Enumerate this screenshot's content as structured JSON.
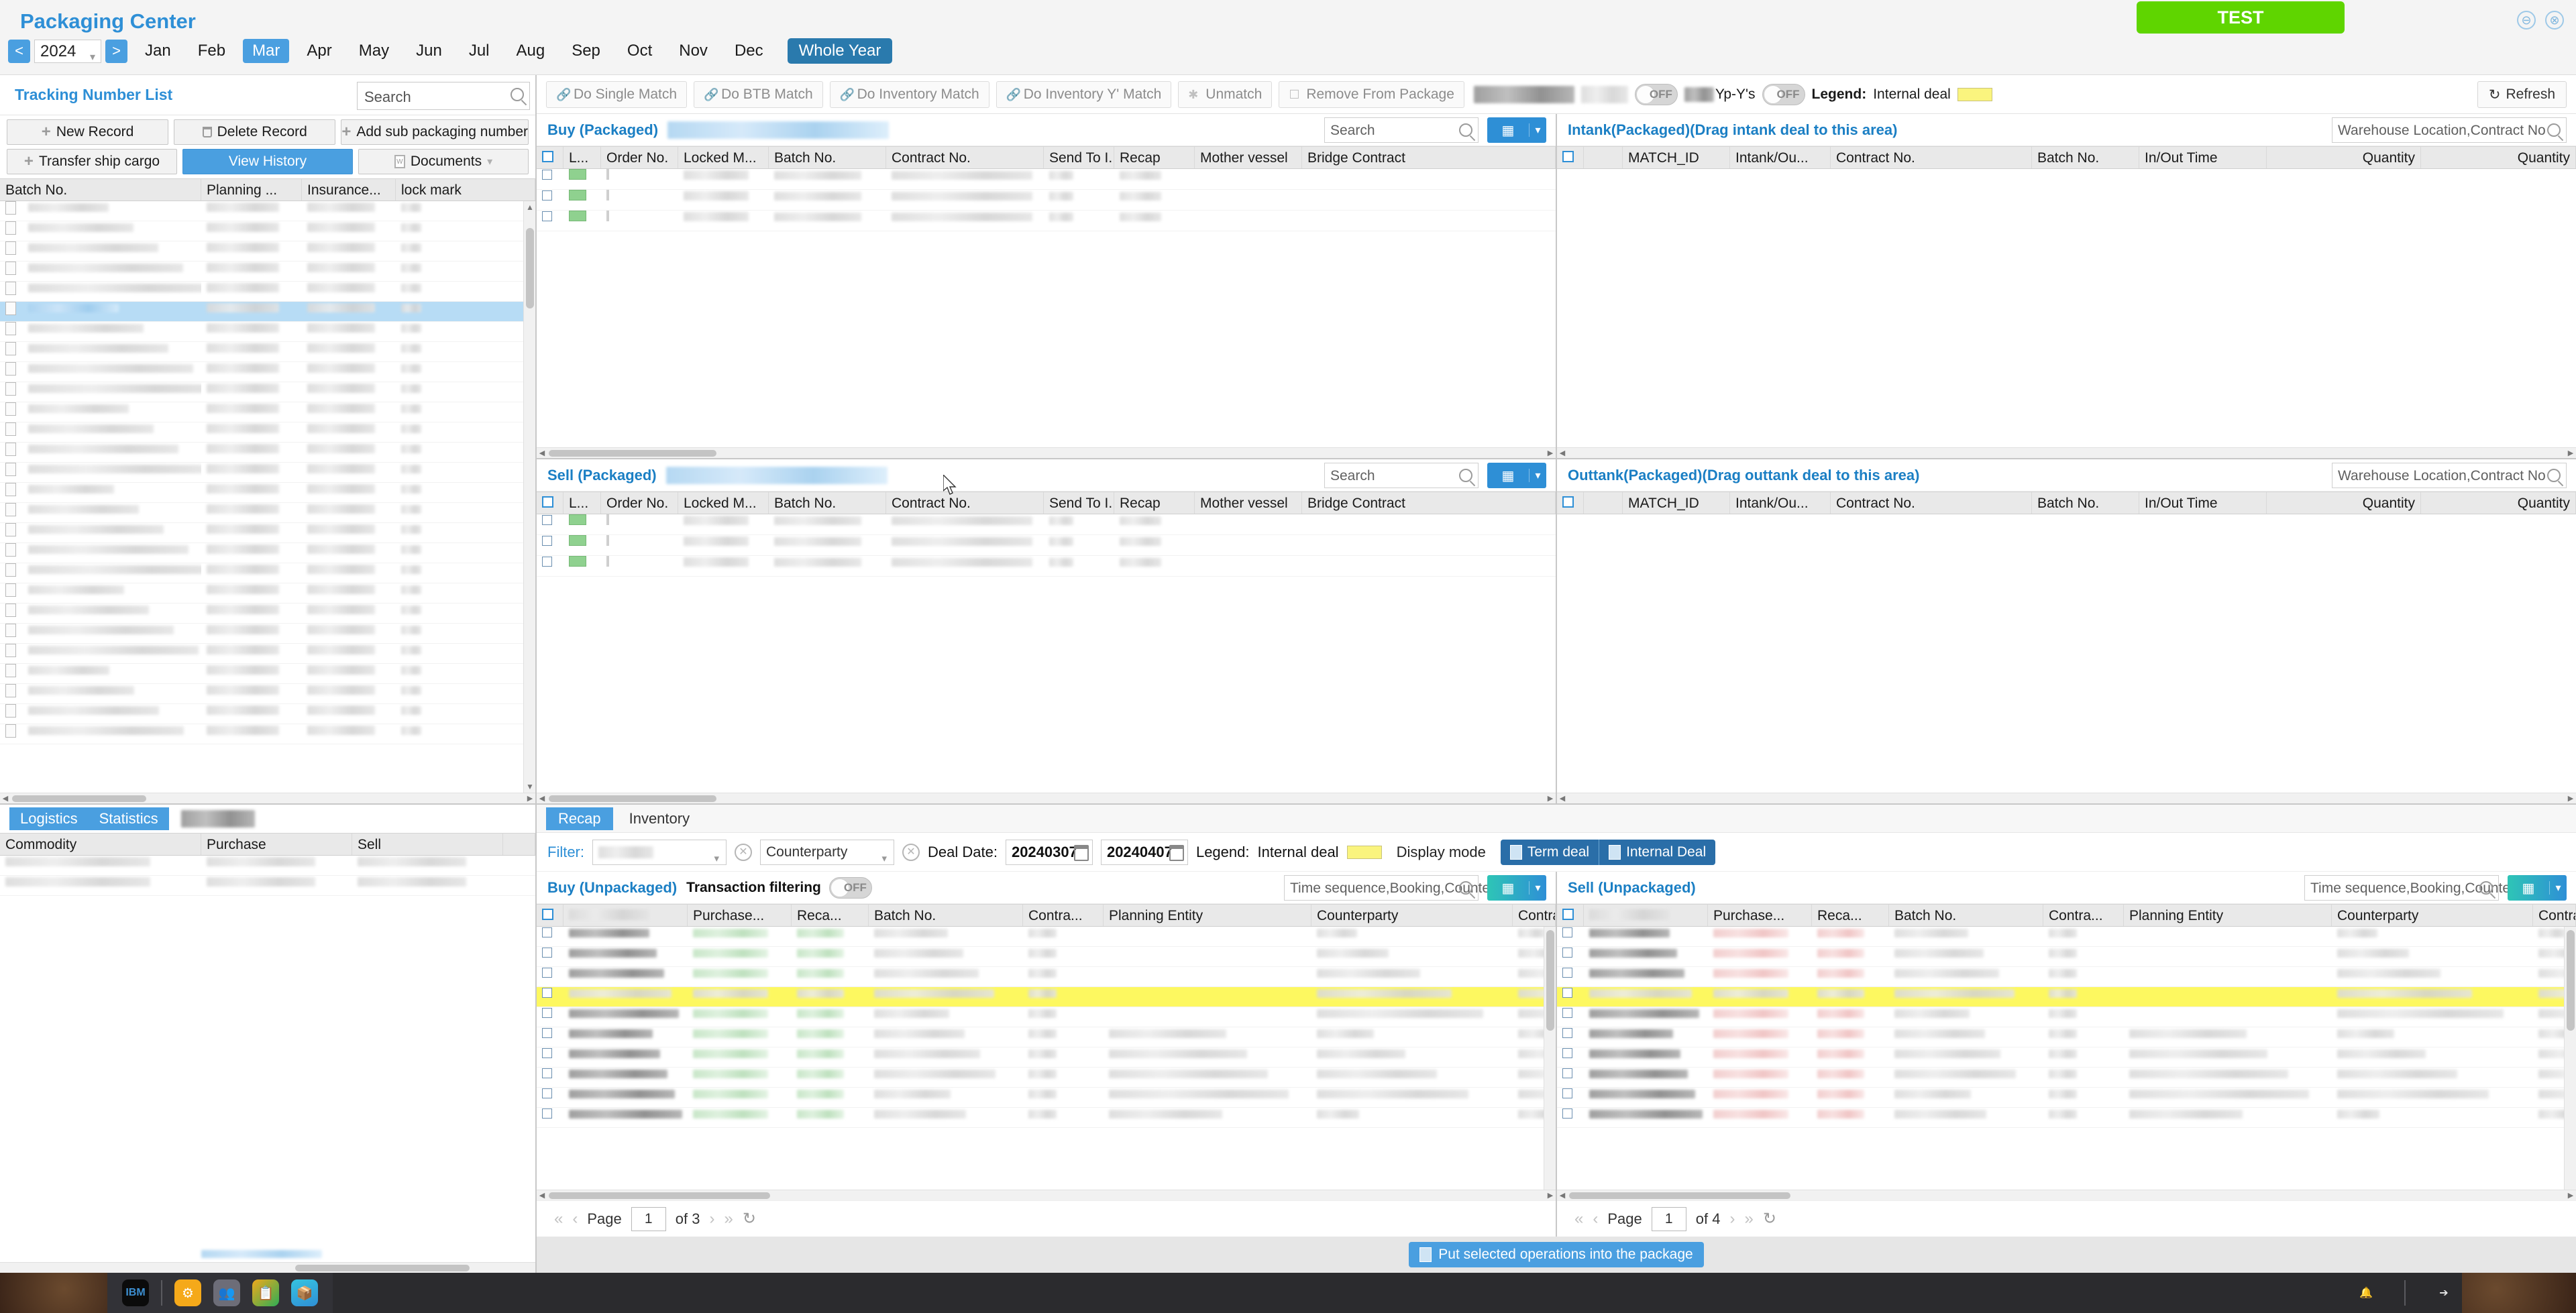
{
  "header": {
    "title": "Packaging Center",
    "year": "2024",
    "prev": "<",
    "next": ">",
    "months": [
      "Jan",
      "Feb",
      "Mar",
      "Apr",
      "May",
      "Jun",
      "Jul",
      "Aug",
      "Sep",
      "Oct",
      "Nov",
      "Dec"
    ],
    "active_month": "Mar",
    "whole_year": "Whole Year",
    "test_label": "TEST",
    "minimize_icon": "⊖",
    "close_icon": "⊗",
    "accent": "#4a9fe0",
    "test_color": "#5fd500"
  },
  "sidebar": {
    "title": "Tracking Number List",
    "search_placeholder": "Search",
    "buttons_row1": [
      "New Record",
      "Delete Record",
      "Add sub packaging number"
    ],
    "buttons_row2": [
      "Transfer ship cargo",
      "View History",
      "Documents"
    ],
    "columns": [
      "Batch No.",
      "Planning ...",
      "Insurance...",
      "lock mark"
    ],
    "selected_row_index": 5,
    "row_count": 27
  },
  "left_bottom": {
    "tabs": [
      "Logistics",
      "Statistics"
    ],
    "active_tab": "Logistics",
    "columns": [
      "Commodity",
      "Purchase",
      "Sell",
      ""
    ]
  },
  "toolbar": {
    "buttons": [
      "Do Single Match",
      "Do BTB Match",
      "Do Inventory Match",
      "Do Inventory Y' Match",
      "Unmatch",
      "Remove From Package"
    ],
    "toggle1_label": "OFF",
    "yp_label": "Yp-Y's",
    "toggle2_label": "OFF",
    "legend_label": "Legend:",
    "legend_text": "Internal deal",
    "legend_color": "#faf47e",
    "refresh_label": "Refresh"
  },
  "quads": {
    "buy_packaged": {
      "title": "Buy (Packaged)",
      "search_placeholder": "Search",
      "columns": [
        "",
        "L...",
        "Order No.",
        "Locked M...",
        "Batch No.",
        "Contract No.",
        "Send To I...",
        "Recap",
        "Mother vessel",
        "Bridge Contract"
      ],
      "row_count": 3
    },
    "sell_packaged": {
      "title": "Sell (Packaged)",
      "search_placeholder": "Search",
      "columns": [
        "",
        "L...",
        "Order No.",
        "Locked M...",
        "Batch No.",
        "Contract No.",
        "Send To I...",
        "Recap",
        "Mother vessel",
        "Bridge Contract"
      ],
      "row_count": 3
    },
    "intank_packaged": {
      "title": "Intank(Packaged)(Drag intank deal to this area)",
      "search_placeholder": "Warehouse Location,Contract No",
      "columns": [
        "",
        "MATCH_ID",
        "Intank/Ou...",
        "Contract No.",
        "Batch No.",
        "In/Out Time",
        "Quantity",
        "Quantity"
      ],
      "row_count": 0
    },
    "outtank_packaged": {
      "title": "Outtank(Packaged)(Drag outtank deal to this area)",
      "search_placeholder": "Warehouse Location,Contract No",
      "columns": [
        "",
        "MATCH_ID",
        "Intank/Ou...",
        "Contract No.",
        "Batch No.",
        "In/Out Time",
        "Quantity",
        "Quantity"
      ],
      "row_count": 0
    }
  },
  "bottom": {
    "tabs": [
      "Recap",
      "Inventory"
    ],
    "active_tab": "Recap",
    "filter_label": "Filter:",
    "filter1_value": "",
    "filter2_value": "Counterparty",
    "deal_date_label": "Deal Date:",
    "deal_date_from": "20240307",
    "deal_date_to": "20240407",
    "legend_label": "Legend:",
    "legend_text": "Internal deal",
    "legend_color": "#faf47e",
    "display_mode_label": "Display mode",
    "display_buttons": [
      "Term deal",
      "Internal Deal"
    ],
    "buy_unpackaged": {
      "title": "Buy (Unpackaged)",
      "transaction_filtering_label": "Transaction filtering",
      "toggle_label": "OFF",
      "search_placeholder": "Time sequence,Booking,Counter",
      "columns": [
        "",
        "",
        "Purchase...",
        "Reca...",
        "Batch No.",
        "Contra...",
        "Planning Entity",
        "Counterparty",
        "Contract"
      ],
      "highlight_row_index": 3,
      "row_count": 10,
      "page": "1",
      "page_of": "of 3"
    },
    "sell_unpackaged": {
      "title": "Sell (Unpackaged)",
      "search_placeholder": "Time sequence,Booking,Counter",
      "columns": [
        "",
        "",
        "Purchase...",
        "Reca...",
        "Batch No.",
        "Contra...",
        "Planning Entity",
        "Counterparty",
        "Contra"
      ],
      "highlight_row_index": 3,
      "row_count": 10,
      "page": "1",
      "page_of": "of 4"
    },
    "page_label": "Page",
    "put_button": "Put selected operations into the package"
  },
  "taskbar": {
    "icons": [
      "ibm-logo-icon",
      "oil-barrel-icon",
      "org-chart-icon",
      "clipboard-icon",
      "package-box-icon"
    ],
    "right_icons": [
      "bell-icon",
      "logout-icon"
    ]
  }
}
